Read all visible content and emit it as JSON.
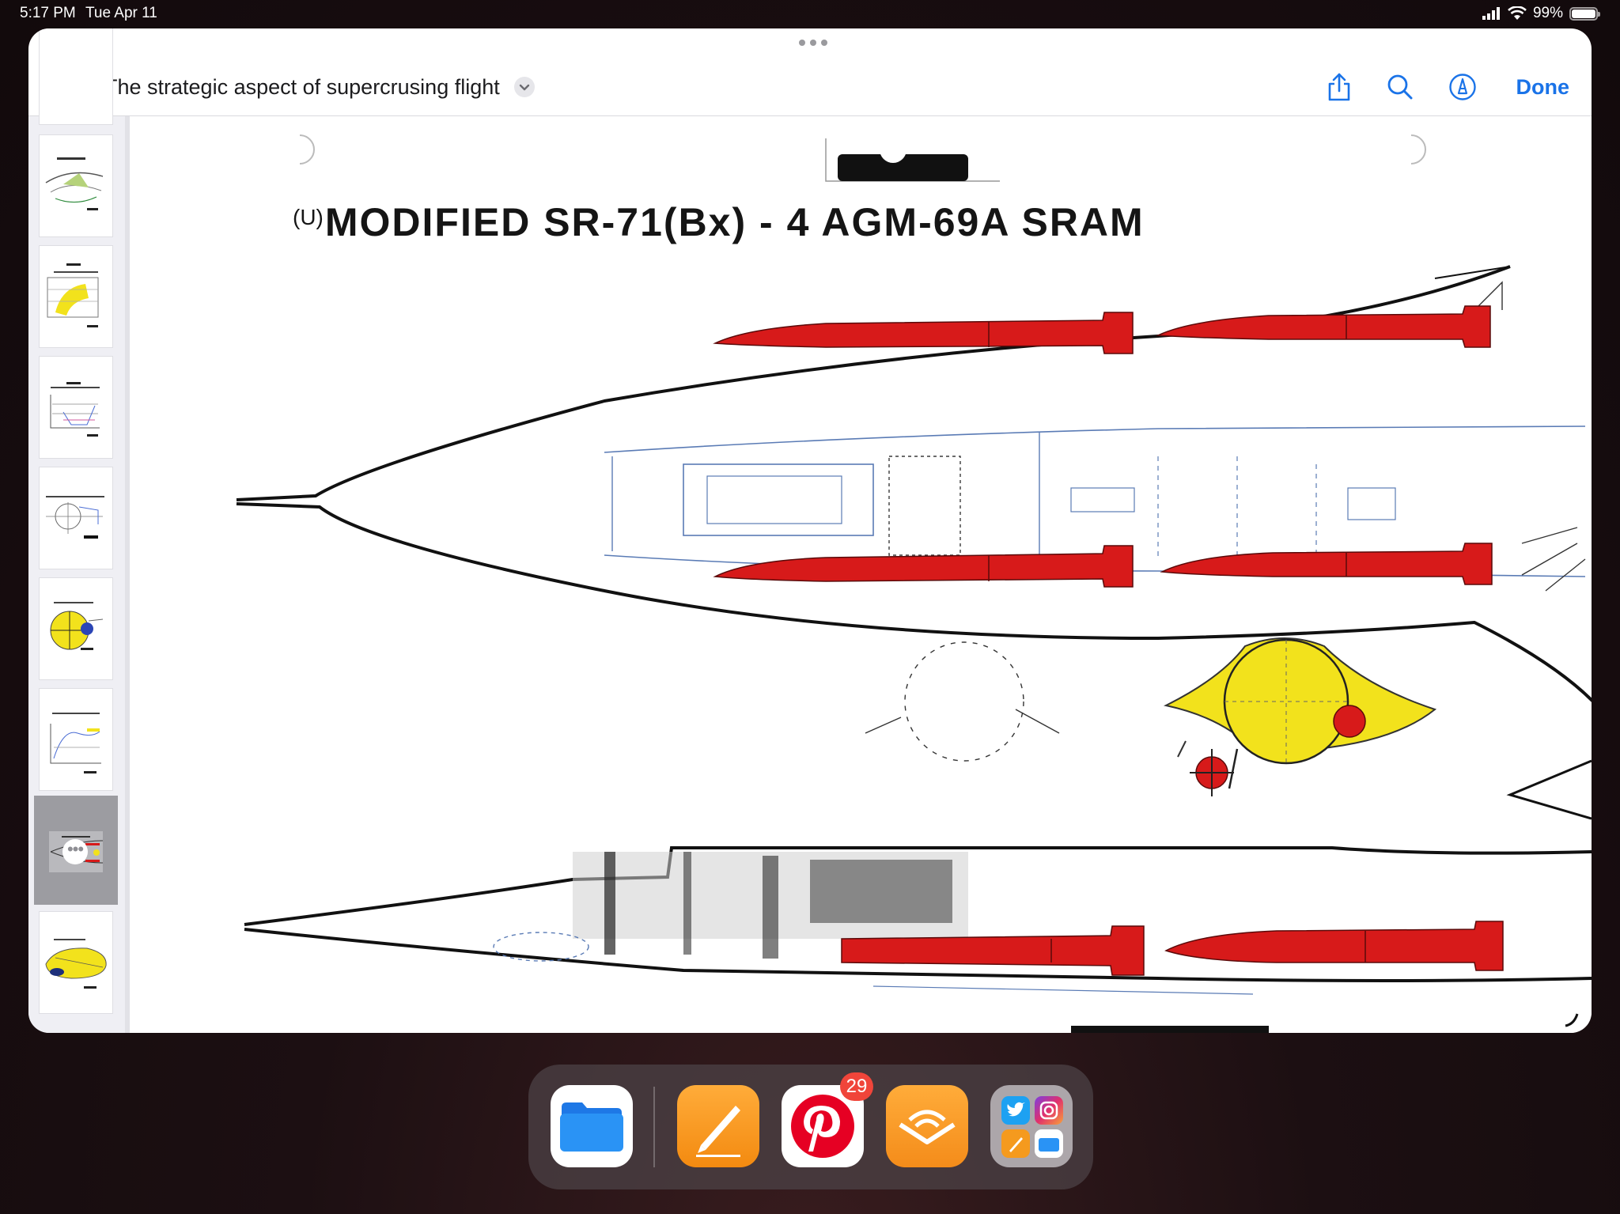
{
  "status_bar": {
    "time": "5:17 PM",
    "date": "Tue Apr 11",
    "battery_text": "99%",
    "battery_level": 0.99
  },
  "toolbar": {
    "title": "The strategic aspect of supercrusing flight",
    "done_label": "Done",
    "icons": [
      "list-icon",
      "chevron-down-icon",
      "share-icon",
      "search-icon",
      "markup-icon"
    ]
  },
  "document": {
    "classification_mark": "(U)",
    "heading": "MODIFIED SR-71(Bx) - 4 AGM-69A SRAM",
    "colors": {
      "missile": "#d71a1a",
      "section": "#f2e21c",
      "line": "#0d0d0d",
      "blueprint": "#5a7bb5"
    }
  },
  "sidebar": {
    "selected_index": 6,
    "thumbnail_count": 8
  },
  "dock": {
    "apps": [
      "Files",
      "Pages",
      "Pinterest",
      "Audible",
      "Recent Apps"
    ],
    "pinterest_badge": "29"
  }
}
